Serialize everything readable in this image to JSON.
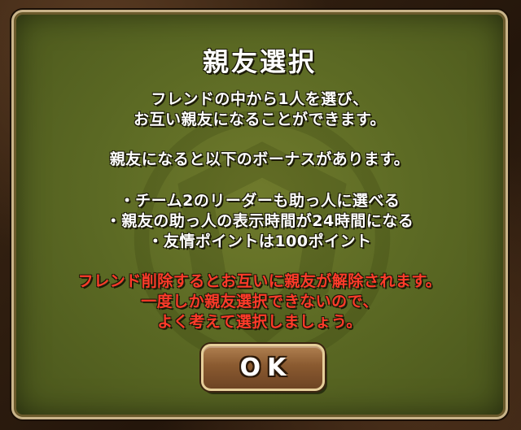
{
  "dialog": {
    "title": "親友選択",
    "intro": [
      "フレンドの中から1人を選び、",
      "お互い親友になることができます。"
    ],
    "bonus_header": "親友になると以下のボーナスがあります。",
    "bonuses": [
      "・チーム2のリーダーも助っ人に選べる",
      "・親友の助っ人の表示時間が24時間になる",
      "・友情ポイントは100ポイント"
    ],
    "warnings": [
      "フレンド削除するとお互いに親友が解除されます。",
      "一度しか親友選択できないので、",
      "よく考えて選択しましょう。"
    ],
    "ok_label": "OK"
  },
  "colors": {
    "panel": "#5c6a24",
    "warning_text": "#ff3b2a",
    "button": "#8a5a30"
  },
  "icons": {
    "background_emblem": "shield-emblem-icon"
  }
}
